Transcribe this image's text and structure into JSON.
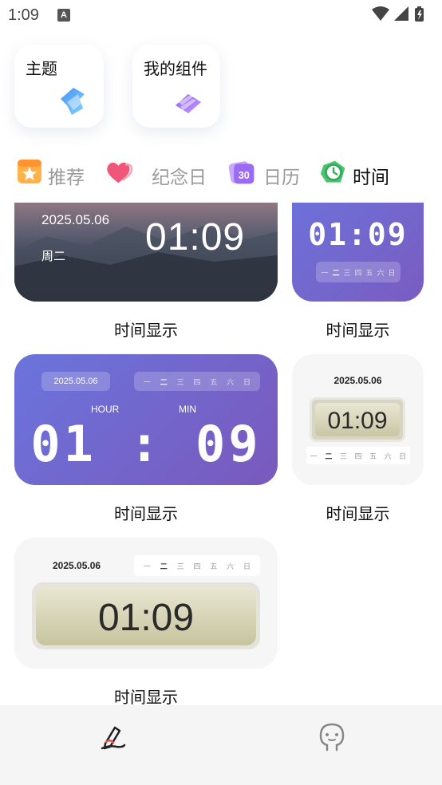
{
  "status_bar": {
    "time": "1:09",
    "notification_glyph": "A"
  },
  "top_cards": [
    {
      "label": "主题",
      "icon": "theme-icon"
    },
    {
      "label": "我的组件",
      "icon": "widget-stack-icon"
    }
  ],
  "categories": [
    {
      "label": "推荐",
      "icon": "star-badge-icon",
      "active": false
    },
    {
      "label": "纪念日",
      "icon": "heart-icon",
      "active": false
    },
    {
      "label": "日历",
      "icon": "calendar-30-icon",
      "icon_text": "30",
      "active": false
    },
    {
      "label": "时间",
      "icon": "clock-icon",
      "active": true
    }
  ],
  "widgets": {
    "w1": {
      "date": "2025.05.06",
      "weekday": "周二",
      "time": "01:09",
      "caption": "时间显示"
    },
    "w2": {
      "time": "01:09",
      "caption": "时间显示"
    },
    "w3": {
      "date": "2025.05.06",
      "hour_label": "HOUR",
      "min_label": "MIN",
      "time": "01 : 09",
      "caption": "时间显示"
    },
    "w4": {
      "date": "2025.05.06",
      "time": "01:09",
      "caption": "时间显示"
    },
    "w5": {
      "date": "2025.05.06",
      "time": "01:09",
      "caption": "时间显示"
    }
  },
  "weekdays": [
    "一",
    "二",
    "三",
    "四",
    "五",
    "六",
    "日"
  ],
  "bottom_nav": [
    {
      "icon": "pen-sign-icon",
      "active": true
    },
    {
      "icon": "profile-face-icon",
      "active": false
    }
  ],
  "colors": {
    "purple_start": "#6a74dc",
    "purple_end": "#7a59bc",
    "active_text": "#111111",
    "inactive_text": "#9a9a9a"
  }
}
